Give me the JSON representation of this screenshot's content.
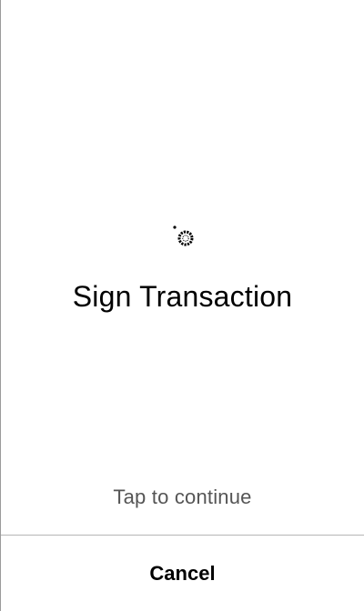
{
  "screen": {
    "title": "Sign Transaction",
    "hint": "Tap to continue",
    "loading_icon": "spinner-icon"
  },
  "footer": {
    "cancel_label": "Cancel"
  },
  "colors": {
    "text_primary": "#000000",
    "text_secondary": "#555555",
    "divider": "#b5b5b5",
    "background": "#ffffff"
  }
}
